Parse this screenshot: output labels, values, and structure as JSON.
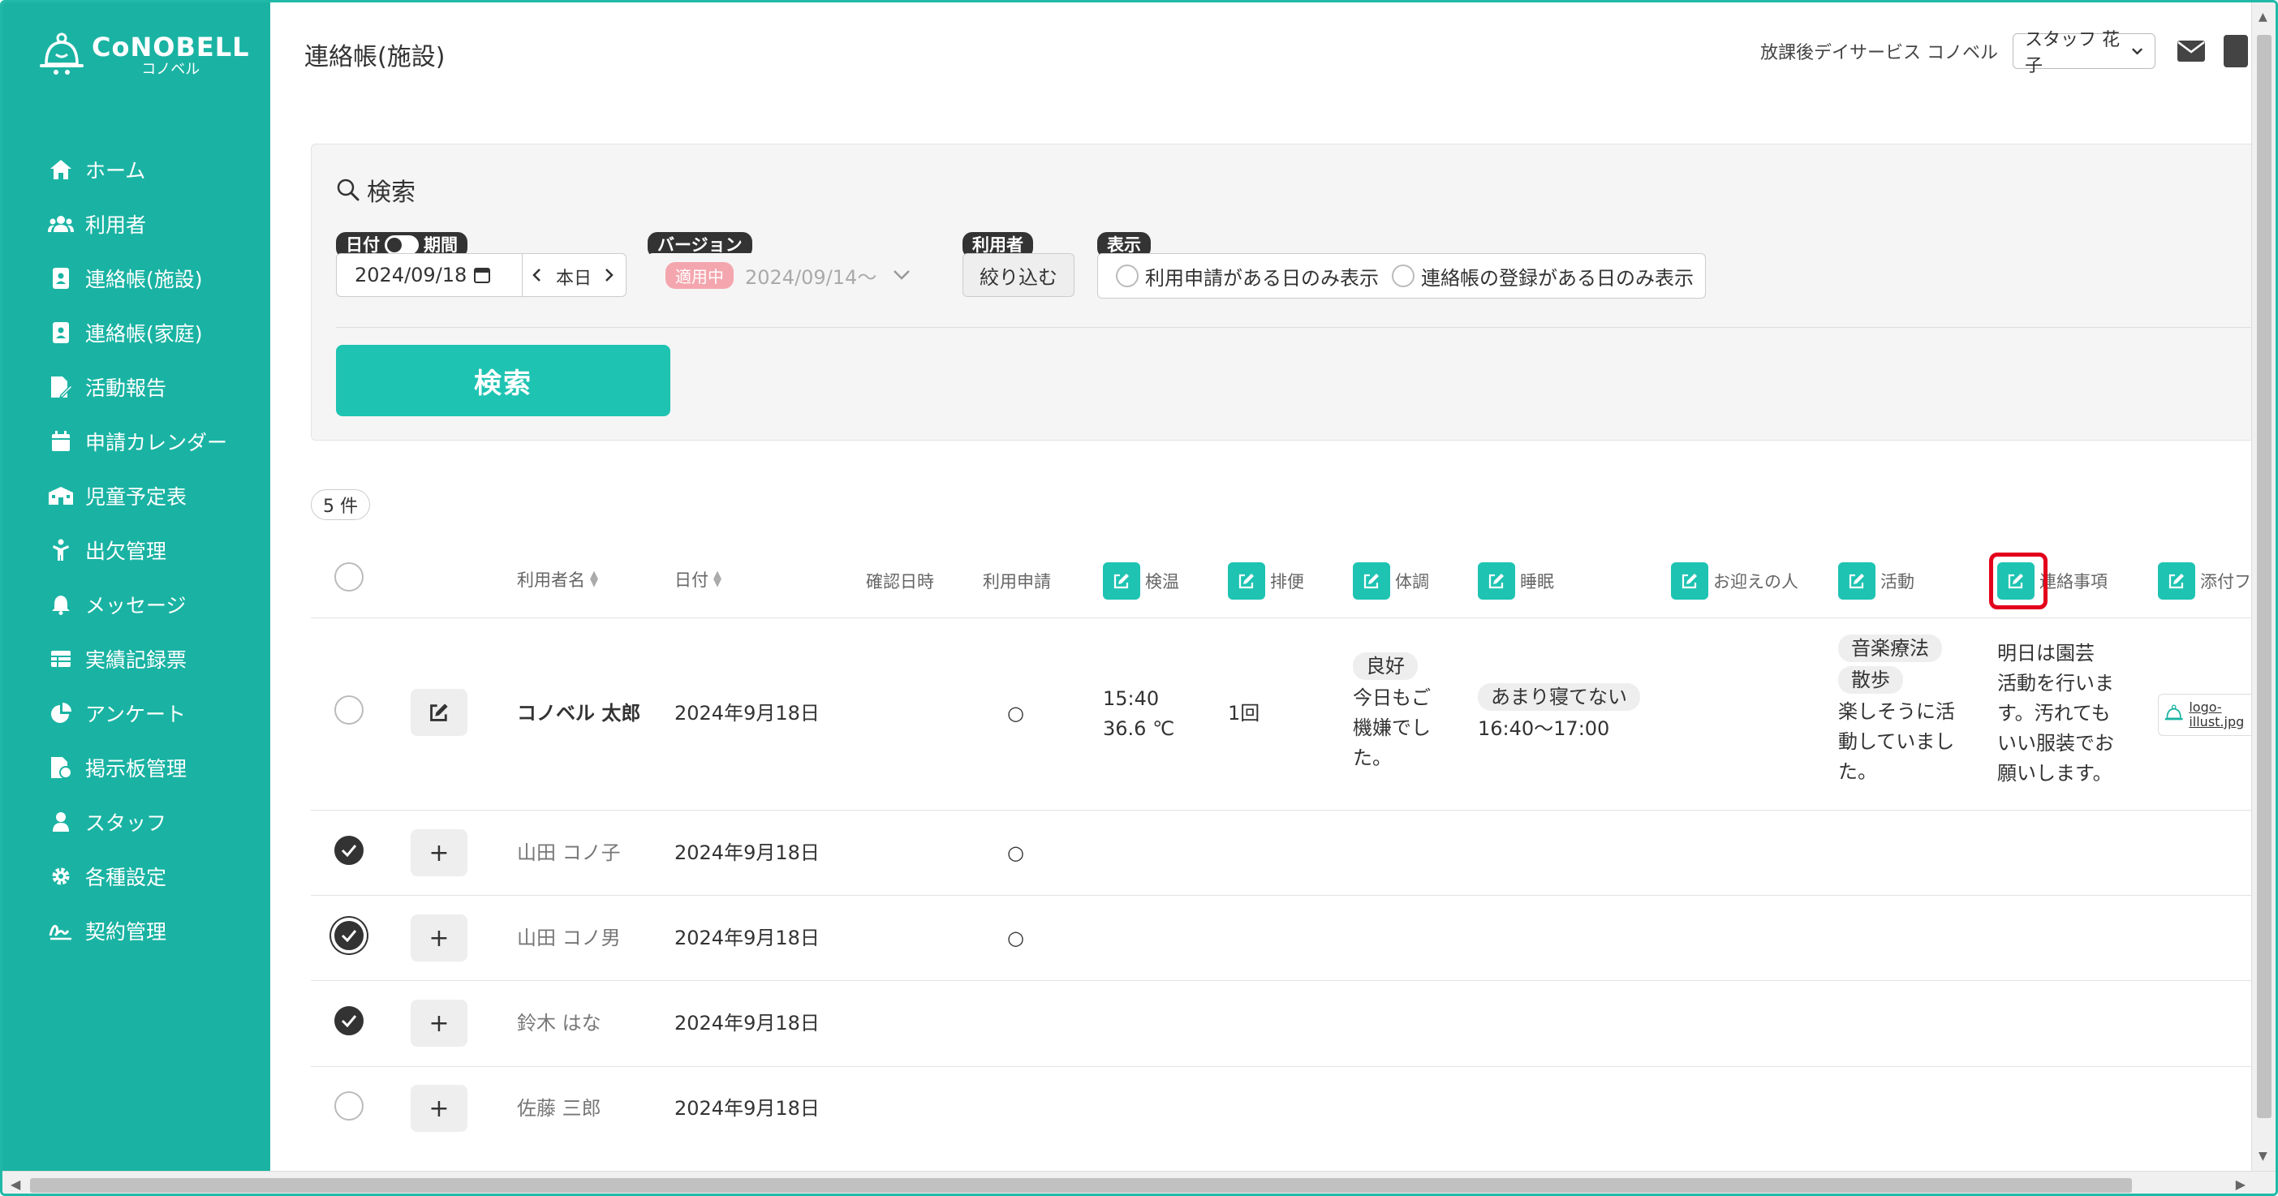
{
  "brand": {
    "name": "CoNOBELL",
    "sub": "コノベル"
  },
  "nav": [
    {
      "label": "ホーム",
      "icon": "home-icon"
    },
    {
      "label": "利用者",
      "icon": "users-icon"
    },
    {
      "label": "連絡帳(施設)",
      "icon": "contact-book-icon"
    },
    {
      "label": "連絡帳(家庭)",
      "icon": "contact-book-icon"
    },
    {
      "label": "活動報告",
      "icon": "report-icon"
    },
    {
      "label": "申請カレンダー",
      "icon": "calendar-icon"
    },
    {
      "label": "児童予定表",
      "icon": "schedule-icon"
    },
    {
      "label": "出欠管理",
      "icon": "attendance-icon"
    },
    {
      "label": "メッセージ",
      "icon": "bell-icon"
    },
    {
      "label": "実績記録票",
      "icon": "table-icon"
    },
    {
      "label": "アンケート",
      "icon": "pie-chart-icon"
    },
    {
      "label": "掲示板管理",
      "icon": "board-icon"
    },
    {
      "label": "スタッフ",
      "icon": "staff-icon"
    },
    {
      "label": "各種設定",
      "icon": "gear-icon"
    },
    {
      "label": "契約管理",
      "icon": "signature-icon"
    }
  ],
  "header": {
    "title": "連絡帳(施設)",
    "facility": "放課後デイサービス コノベル",
    "staff": "スタッフ 花子"
  },
  "search": {
    "title": "検索",
    "date_tag": "日付",
    "period_tag": "期間",
    "date_value": "2024/09/18",
    "today_label": "本日",
    "version_tag": "バージョン",
    "version_badge": "適用中",
    "version_value": "2024/09/14〜",
    "user_tag": "利用者",
    "user_button": "絞り込む",
    "display_tag": "表示",
    "option1": "利用申請がある日のみ表示",
    "option2": "連絡帳の登録がある日のみ表示",
    "button": "検索"
  },
  "count": "5 件",
  "columns": {
    "name": "利用者名",
    "date": "日付",
    "confirmed": "確認日時",
    "application": "利用申請",
    "temp": "検温",
    "bowel": "排便",
    "condition": "体調",
    "sleep": "睡眠",
    "pickup": "お迎えの人",
    "activity": "活動",
    "notes": "連絡事項",
    "attachment": "添付フ"
  },
  "rows": [
    {
      "name": "コノベル 太郎",
      "date": "2024年9月18日",
      "application": "○",
      "temp_time": "15:40",
      "temp_value": "36.6 ℃",
      "bowel": "1回",
      "condition_pill": "良好",
      "condition_text": [
        "今日もご",
        "機嫌でし",
        "た。"
      ],
      "sleep_pill": "あまり寝てない",
      "sleep_time": "16:40〜17:00",
      "activity_pills": [
        "音楽療法",
        "散歩"
      ],
      "activity_text": [
        "楽しそうに活",
        "動していまし",
        "た。"
      ],
      "notes_text": [
        "明日は園芸",
        "活動を行いま",
        "す。汚れても",
        "いい服装でお",
        "願いします。"
      ],
      "attachment": "logo-illust.jpg"
    },
    {
      "name": "山田 コノ子",
      "date": "2024年9月18日",
      "application": "○"
    },
    {
      "name": "山田 コノ男",
      "date": "2024年9月18日",
      "application": "○"
    },
    {
      "name": "鈴木 はな",
      "date": "2024年9月18日",
      "application": ""
    },
    {
      "name": "佐藤 三郎",
      "date": "2024年9月18日",
      "application": ""
    }
  ]
}
